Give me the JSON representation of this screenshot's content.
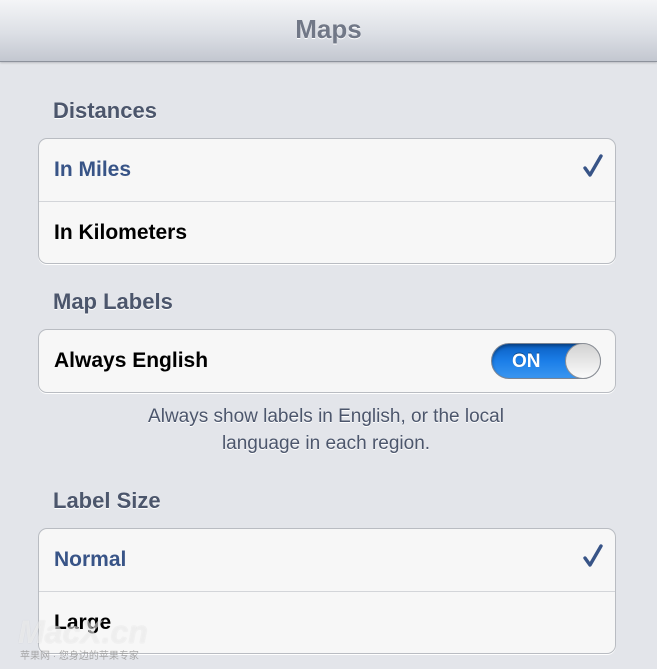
{
  "navbar": {
    "title": "Maps"
  },
  "distances": {
    "header": "Distances",
    "options": [
      {
        "label": "In Miles",
        "selected": true
      },
      {
        "label": "In Kilometers",
        "selected": false
      }
    ]
  },
  "map_labels": {
    "header": "Map Labels",
    "always_english": {
      "label": "Always English",
      "toggle_text": "ON",
      "on": true
    },
    "footer_line1": "Always show labels in English, or the local",
    "footer_line2": "language in each region."
  },
  "label_size": {
    "header": "Label Size",
    "options": [
      {
        "label": "Normal",
        "selected": true
      },
      {
        "label": "Large",
        "selected": false
      }
    ]
  },
  "watermark": {
    "logo_text": "MacX.cn",
    "tagline": "苹果网 · 您身边的苹果专家"
  },
  "colors": {
    "selected_text": "#385487",
    "toggle_on": "#1b7ee8",
    "background": "#e3e5ea"
  }
}
